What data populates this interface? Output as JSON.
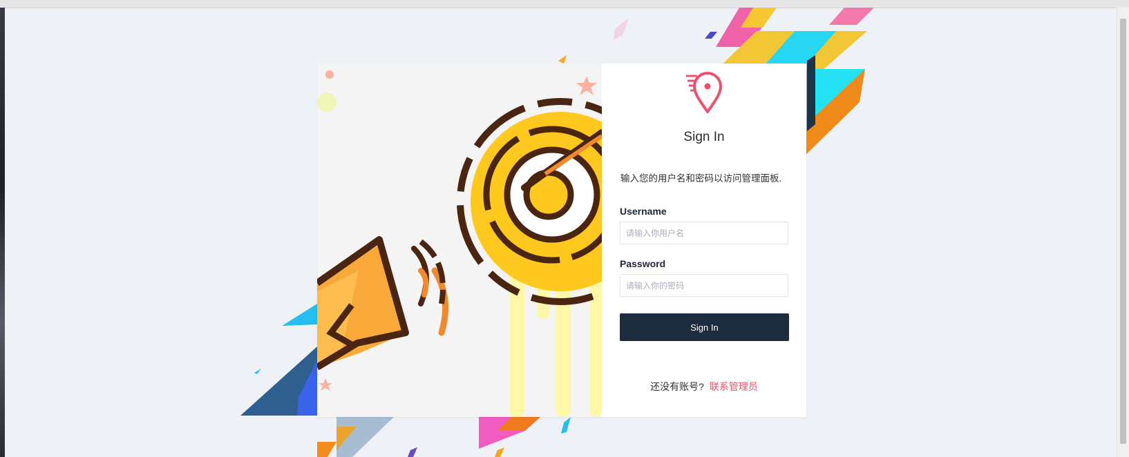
{
  "login": {
    "title": "Sign In",
    "subtitle": "输入您的用户名和密码以访问管理面板.",
    "username_label": "Username",
    "username_placeholder": "请输入你用户名",
    "password_label": "Password",
    "password_placeholder": "请输入你的密码",
    "submit_label": "Sign In",
    "footer_text": "还没有账号?",
    "contact_link": "联系管理员"
  },
  "icons": {
    "logo": "location-pin-icon",
    "illustration": "target-megaphone-illustration"
  },
  "colors": {
    "accent": "#f0506e",
    "button": "#1c2b3e",
    "background": "#eef2f6"
  }
}
